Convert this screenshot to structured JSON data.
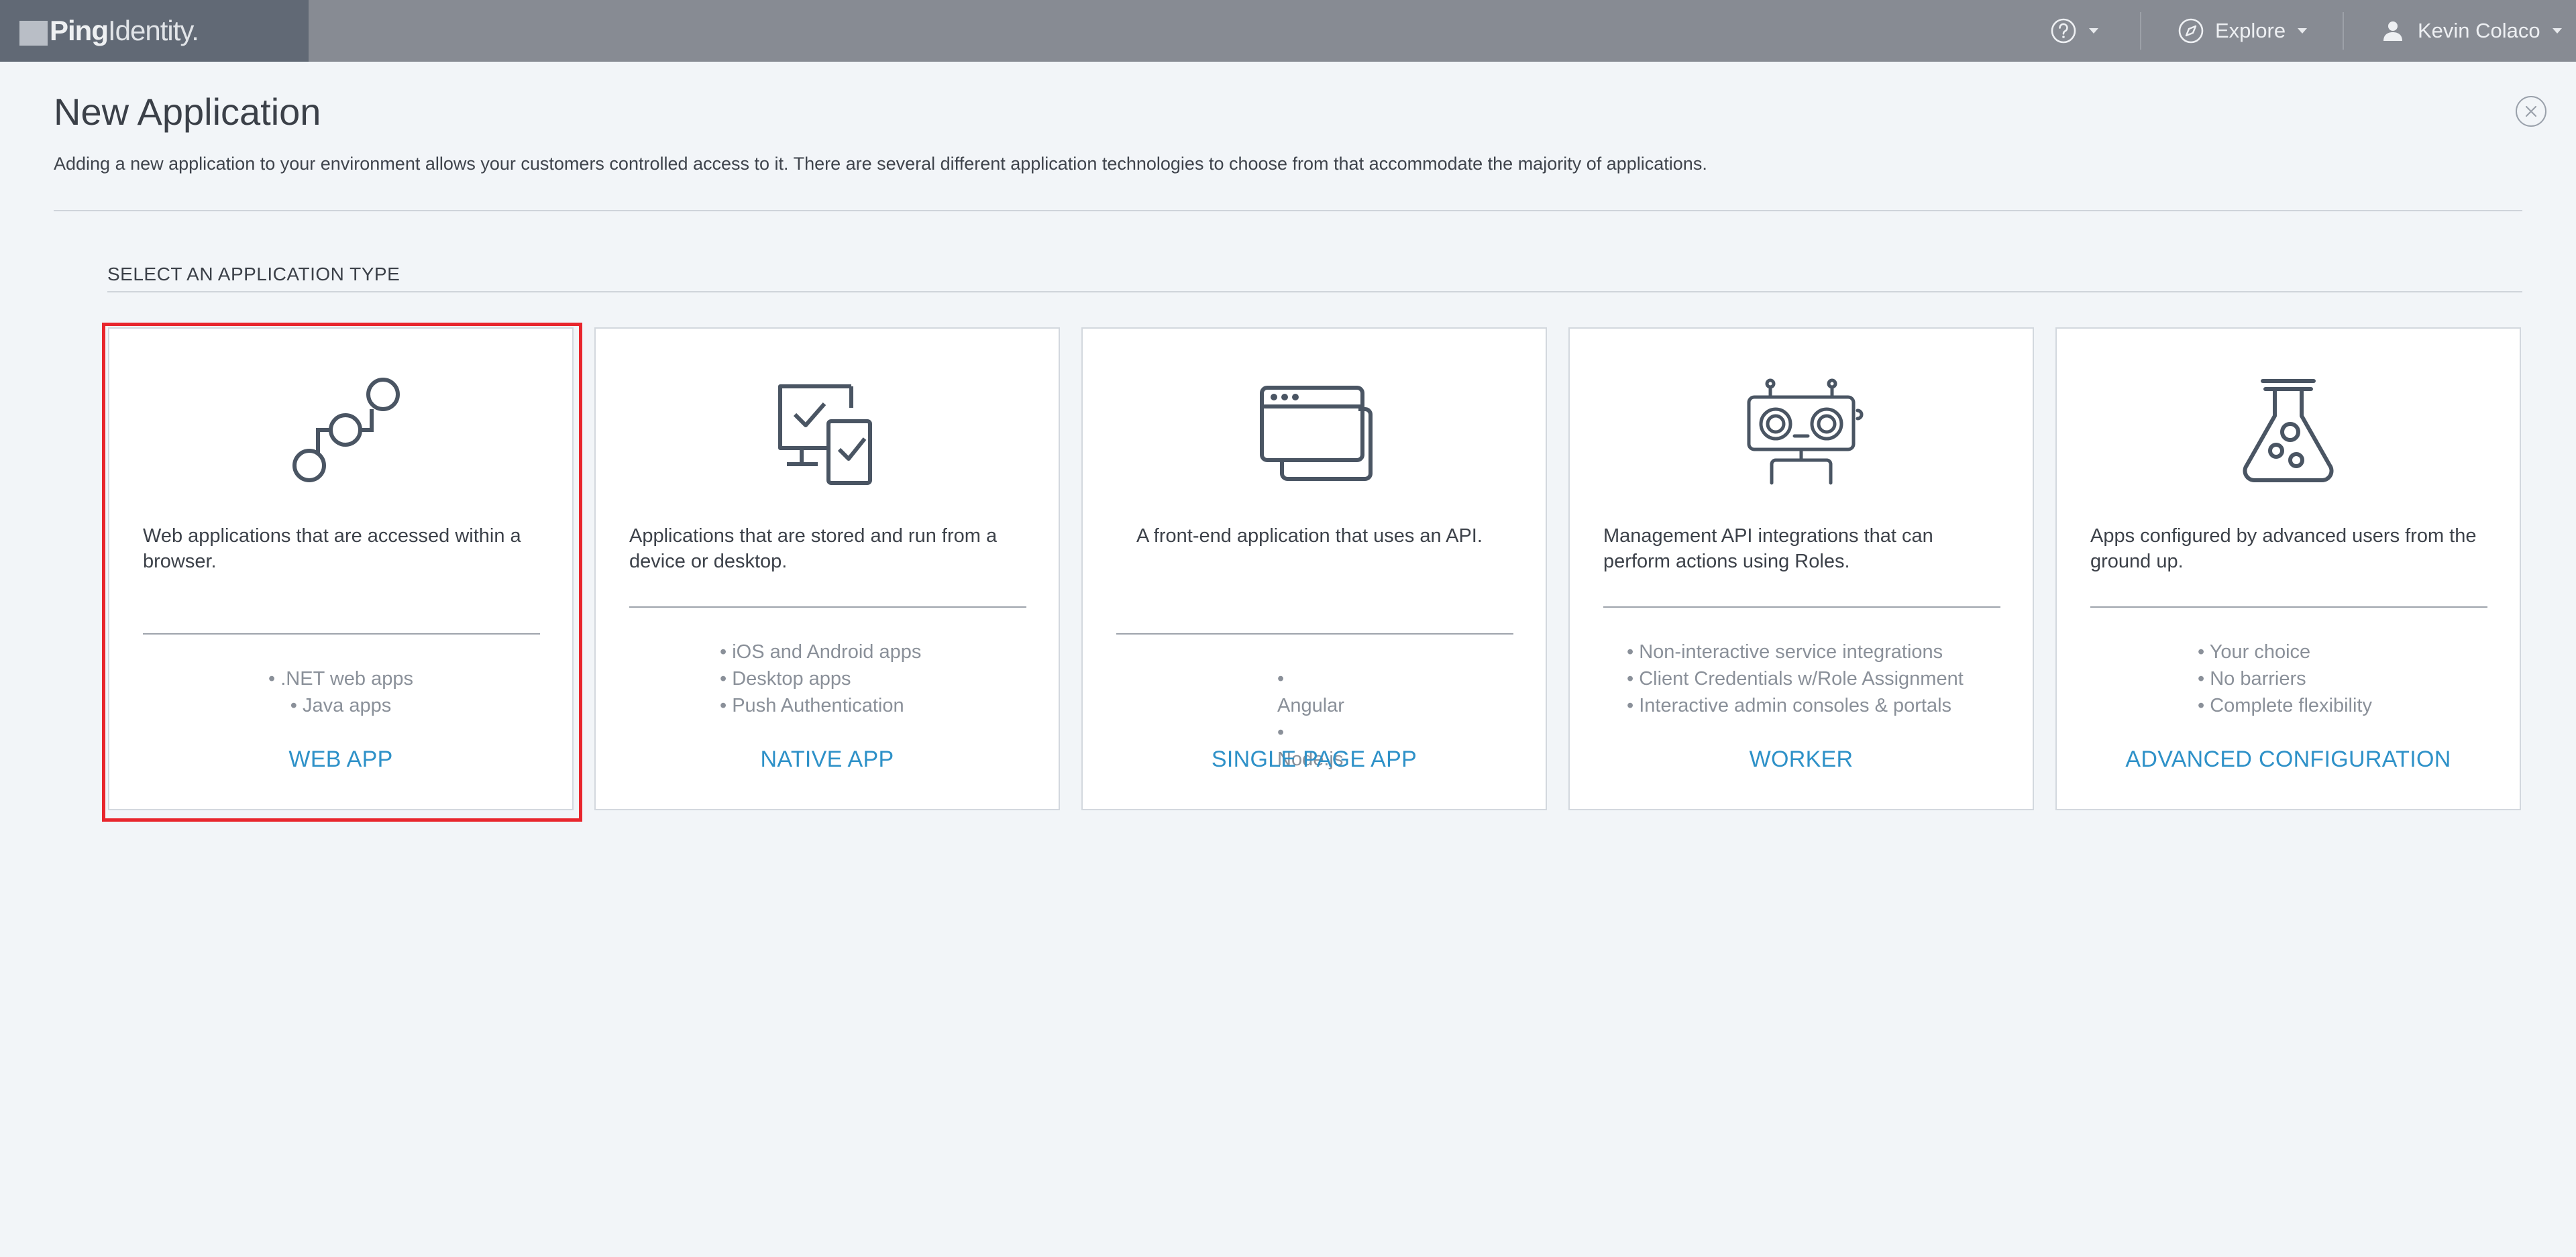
{
  "topbar": {
    "logo_bold": "Ping",
    "logo_light": "Identity.",
    "help_icon": "question-circle-icon",
    "explore_label": "Explore",
    "explore_icon": "compass-icon",
    "user_name": "Kevin Colaco",
    "user_icon": "person-icon"
  },
  "page": {
    "title": "New Application",
    "subtitle": "Adding a new application to your environment allows your customers controlled access to it. There are several different application technologies to choose from that accommodate the majority of applications.",
    "section_label": "SELECT AN APPLICATION TYPE"
  },
  "cards": [
    {
      "icon": "network-nodes-icon",
      "description": "Web applications that are accessed within a browser.",
      "features": [
        ".NET web apps",
        "Java apps"
      ],
      "action": "WEB APP"
    },
    {
      "icon": "desktop-mobile-check-icon",
      "description": "Applications that are stored and run from a device or desktop.",
      "features": [
        "iOS and Android apps",
        "Desktop apps",
        "Push Authentication"
      ],
      "action": "NATIVE APP"
    },
    {
      "icon": "browser-windows-icon",
      "description": "A front-end application that uses an API.",
      "features": [
        "Angular",
        "Node.js"
      ],
      "action": "SINGLE PAGE APP"
    },
    {
      "icon": "robot-icon",
      "description": "Management API integrations that can perform actions using Roles.",
      "features": [
        "Non-interactive service integrations",
        "Client Credentials w/Role Assignment",
        "Interactive admin consoles & portals"
      ],
      "action": "WORKER"
    },
    {
      "icon": "flask-icon",
      "description": "Apps configured by advanced users from the ground up.",
      "features": [
        "Your choice",
        "No barriers",
        "Complete flexibility"
      ],
      "action": "ADVANCED CONFIGURATION"
    }
  ],
  "colors": {
    "accent": "#2e91c8",
    "highlight_border": "#e8262d",
    "topbar": "#878b93",
    "logo_bg": "#616975"
  }
}
